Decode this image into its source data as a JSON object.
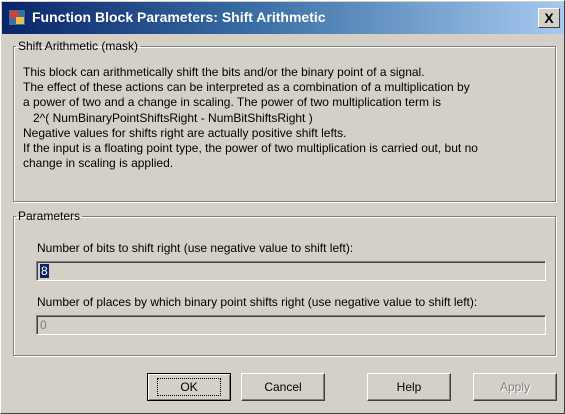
{
  "window": {
    "title": "Function Block Parameters: Shift Arithmetic",
    "app_icon": "simulink-icon",
    "close_label": "X"
  },
  "mask_group": {
    "legend": "Shift Arithmetic (mask)",
    "lines": [
      "This block can arithmetically shift the bits and/or the binary point of a signal.",
      "The effect of these actions can be interpreted as a combination of a multiplication by",
      "a power of two and a change in scaling.  The power of two multiplication term is",
      "2^( NumBinaryPointShiftsRight - NumBitShiftsRight )",
      "Negative values for shifts right are actually positive shift lefts.",
      "If the input is a floating point type, the power of two multiplication is carried out, but no",
      "change in scaling is applied."
    ]
  },
  "params_group": {
    "legend": "Parameters",
    "bits_label": "Number of bits to shift right (use negative value to shift left):",
    "bits_value": "8",
    "point_label": "Number of places by which binary point shifts right (use negative value to shift left):",
    "point_value": "0"
  },
  "buttons": {
    "ok": "OK",
    "cancel": "Cancel",
    "help": "Help",
    "apply": "Apply"
  }
}
